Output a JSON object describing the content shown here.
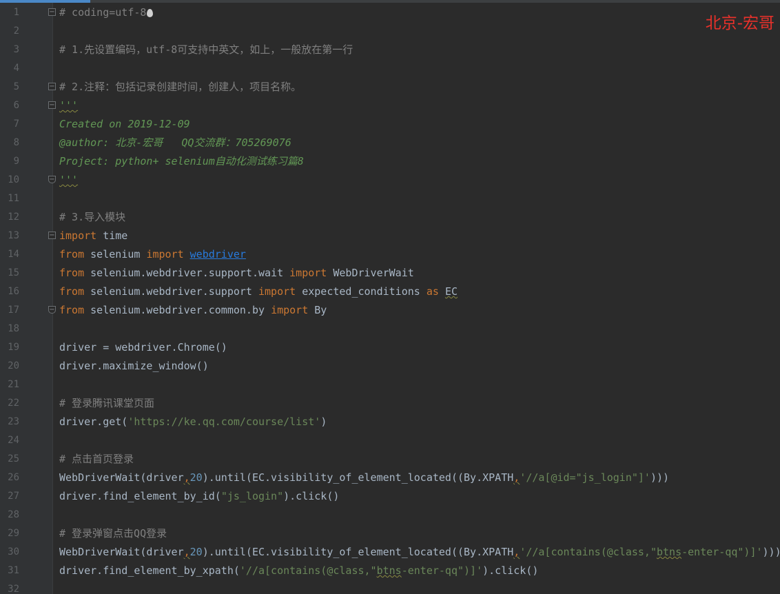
{
  "watermark": "北京-宏哥",
  "colors": {
    "background": "#2b2b2b",
    "keyword": "#cc7832",
    "comment": "#808080",
    "docstring": "#629755",
    "string": "#6a8759",
    "number": "#6897bb",
    "link": "#287bde",
    "watermark": "#e8312b"
  },
  "editor": {
    "lines": [
      {
        "number": "1",
        "fold": "start",
        "segments": [
          {
            "t": "# coding=utf-8",
            "c": "cm"
          }
        ]
      },
      {
        "number": "2",
        "segments": []
      },
      {
        "number": "3",
        "segments": [
          {
            "t": "# 1.先设置编码，utf-8可支持中英文，如上，一般放在第一行",
            "c": "cm"
          }
        ]
      },
      {
        "number": "4",
        "segments": []
      },
      {
        "number": "5",
        "fold": "start",
        "segments": [
          {
            "t": "# 2.注释：包括记录创建时间，创建人，项目名称。",
            "c": "cm"
          }
        ]
      },
      {
        "number": "6",
        "fold": "start",
        "segments": [
          {
            "t": "'''",
            "c": "doc wavy"
          }
        ]
      },
      {
        "number": "7",
        "segments": [
          {
            "t": "Created on 2019-12-09",
            "c": "doc"
          }
        ]
      },
      {
        "number": "8",
        "segments": [
          {
            "t": "@author: 北京-宏哥   QQ交流群：705269076",
            "c": "doc"
          }
        ]
      },
      {
        "number": "9",
        "segments": [
          {
            "t": "Project: python+ selenium自动化测试练习篇8",
            "c": "doc"
          }
        ]
      },
      {
        "number": "10",
        "fold": "end",
        "segments": [
          {
            "t": "'''",
            "c": "doc wavy"
          }
        ]
      },
      {
        "number": "11",
        "segments": []
      },
      {
        "number": "12",
        "segments": [
          {
            "t": "# 3.导入模块",
            "c": "cm"
          }
        ]
      },
      {
        "number": "13",
        "fold": "start",
        "segments": [
          {
            "t": "import",
            "c": "kw"
          },
          {
            "t": " time",
            "c": "plain"
          }
        ]
      },
      {
        "number": "14",
        "segments": [
          {
            "t": "from",
            "c": "kw"
          },
          {
            "t": " selenium ",
            "c": "plain"
          },
          {
            "t": "import",
            "c": "kw"
          },
          {
            "t": " ",
            "c": "plain"
          },
          {
            "t": "webdriver",
            "c": "link"
          }
        ]
      },
      {
        "number": "15",
        "segments": [
          {
            "t": "from",
            "c": "kw"
          },
          {
            "t": " selenium.webdriver.support.wait ",
            "c": "plain"
          },
          {
            "t": "import",
            "c": "kw"
          },
          {
            "t": " WebDriverWait",
            "c": "plain"
          }
        ]
      },
      {
        "number": "16",
        "segments": [
          {
            "t": "from",
            "c": "kw"
          },
          {
            "t": " selenium.webdriver.support ",
            "c": "plain"
          },
          {
            "t": "import",
            "c": "kw"
          },
          {
            "t": " expected_conditions ",
            "c": "plain"
          },
          {
            "t": "as",
            "c": "kw"
          },
          {
            "t": " ",
            "c": "plain"
          },
          {
            "t": "EC",
            "c": "plain wavy"
          }
        ]
      },
      {
        "number": "17",
        "fold": "end",
        "segments": [
          {
            "t": "from",
            "c": "kw"
          },
          {
            "t": " selenium.webdriver.common.by ",
            "c": "plain"
          },
          {
            "t": "import",
            "c": "kw"
          },
          {
            "t": " By",
            "c": "plain"
          }
        ]
      },
      {
        "number": "18",
        "segments": []
      },
      {
        "number": "19",
        "segments": [
          {
            "t": "driver = webdriver.Chrome()",
            "c": "plain"
          }
        ]
      },
      {
        "number": "20",
        "segments": [
          {
            "t": "driver.maximize_window()",
            "c": "plain"
          }
        ]
      },
      {
        "number": "21",
        "segments": []
      },
      {
        "number": "22",
        "segments": [
          {
            "t": "# 登录腾讯课堂页面",
            "c": "cm"
          }
        ]
      },
      {
        "number": "23",
        "segments": [
          {
            "t": "driver.get(",
            "c": "plain"
          },
          {
            "t": "'https://ke.qq.com/course/list'",
            "c": "str"
          },
          {
            "t": ")",
            "c": "plain"
          }
        ]
      },
      {
        "number": "24",
        "segments": []
      },
      {
        "number": "25",
        "segments": [
          {
            "t": "# 点击首页登录",
            "c": "cm"
          }
        ]
      },
      {
        "number": "26",
        "segments": [
          {
            "t": "WebDriverWait(driver",
            "c": "plain"
          },
          {
            "t": ",",
            "c": "kw wavy"
          },
          {
            "t": "20",
            "c": "num"
          },
          {
            "t": ").until(EC.visibility_of_element_located((By.XPATH",
            "c": "plain"
          },
          {
            "t": ",",
            "c": "kw wavy"
          },
          {
            "t": "'//a[@id=\"js_login\"]'",
            "c": "str"
          },
          {
            "t": ")))",
            "c": "plain"
          }
        ]
      },
      {
        "number": "27",
        "segments": [
          {
            "t": "driver.find_element_by_id(",
            "c": "plain"
          },
          {
            "t": "\"js_login\"",
            "c": "str"
          },
          {
            "t": ").click()",
            "c": "plain"
          }
        ]
      },
      {
        "number": "28",
        "segments": []
      },
      {
        "number": "29",
        "segments": [
          {
            "t": "# 登录弹窗点击QQ登录",
            "c": "cm"
          }
        ]
      },
      {
        "number": "30",
        "segments": [
          {
            "t": "WebDriverWait(driver",
            "c": "plain"
          },
          {
            "t": ",",
            "c": "kw wavy"
          },
          {
            "t": "20",
            "c": "num"
          },
          {
            "t": ").until(EC.visibility_of_element_located((By.XPATH",
            "c": "plain"
          },
          {
            "t": ",",
            "c": "kw wavy"
          },
          {
            "t": "'//a[contains(@class,\"",
            "c": "str"
          },
          {
            "t": "btns",
            "c": "str wavy"
          },
          {
            "t": "-enter-qq\")]'",
            "c": "str"
          },
          {
            "t": ")))",
            "c": "plain"
          }
        ]
      },
      {
        "number": "31",
        "segments": [
          {
            "t": "driver.find_element_by_xpath(",
            "c": "plain"
          },
          {
            "t": "'//a[contains(@class,\"",
            "c": "str"
          },
          {
            "t": "btns",
            "c": "str wavy"
          },
          {
            "t": "-enter-qq\")]'",
            "c": "str"
          },
          {
            "t": ").click()",
            "c": "plain"
          }
        ]
      },
      {
        "number": "32",
        "segments": []
      }
    ]
  }
}
